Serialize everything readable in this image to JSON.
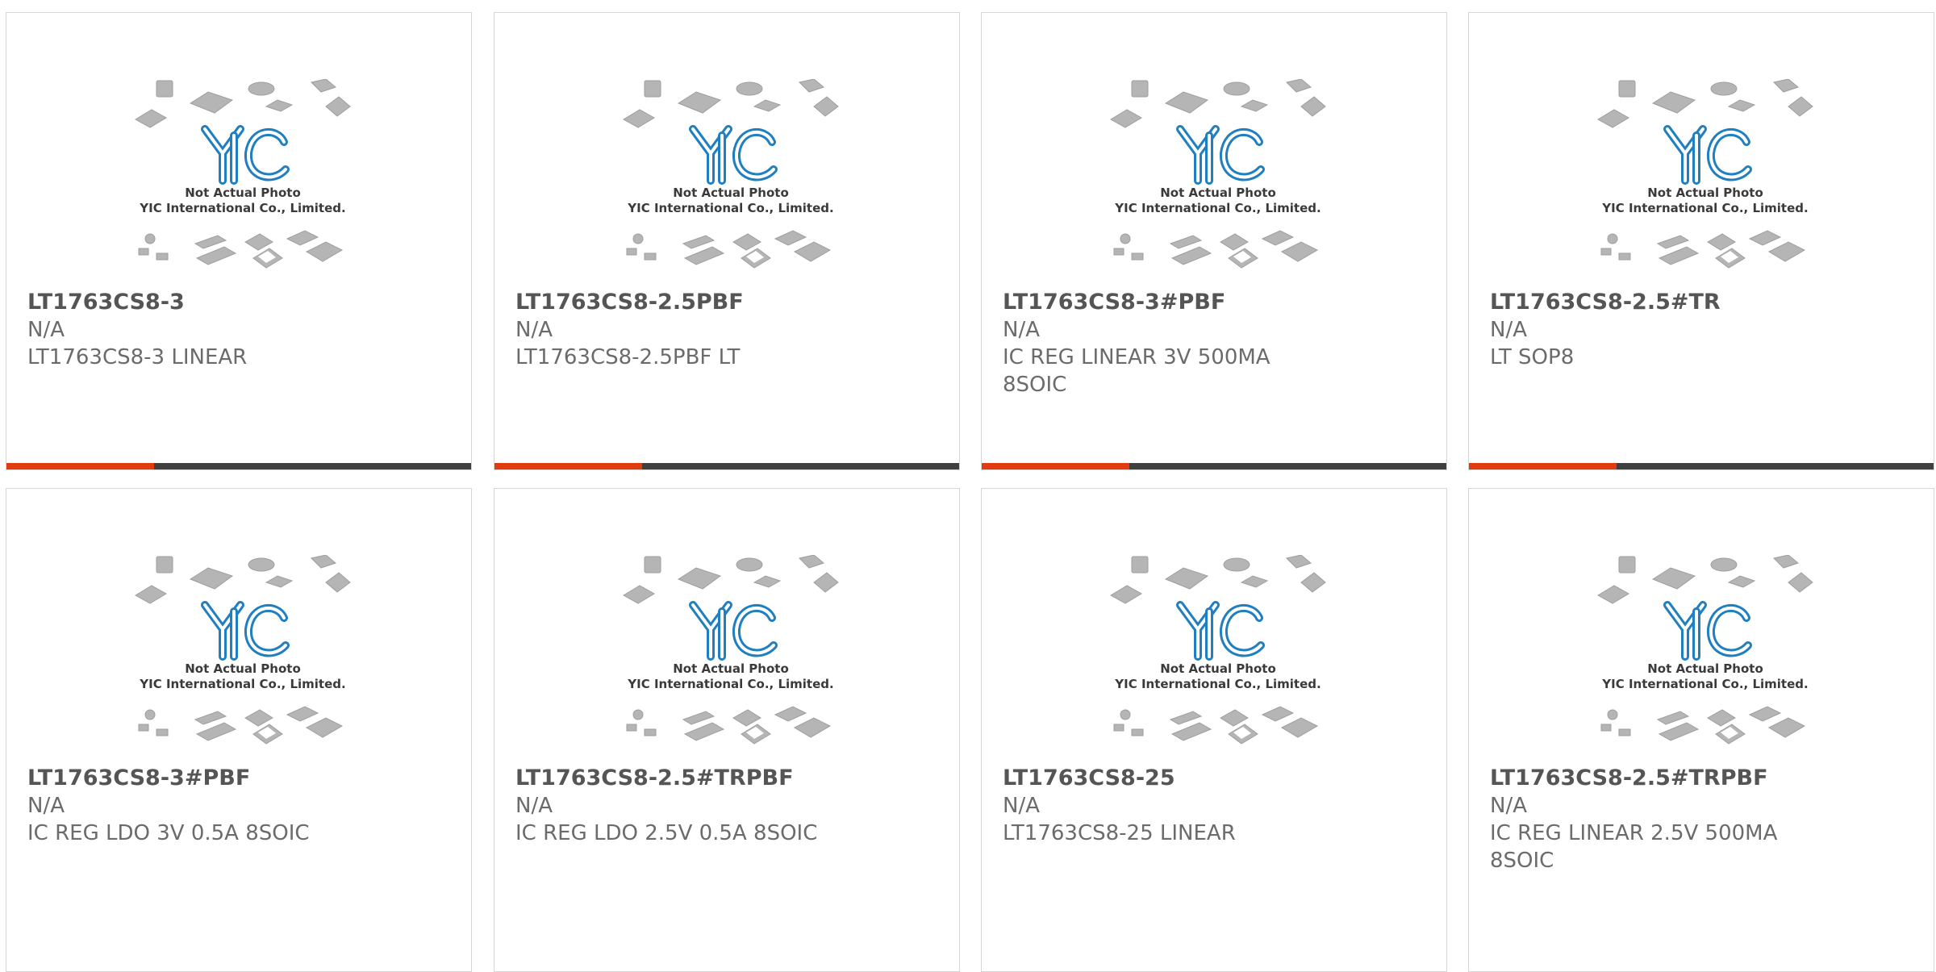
{
  "image_caption": {
    "line1": "Not Actual Photo",
    "line2": "YIC International Co., Limited.",
    "logo_text": "YIC"
  },
  "colors": {
    "accent": "#e03c10",
    "bar_dark": "#3f3f3f",
    "logo_blue": "#1f7fc1"
  },
  "products": [
    {
      "part": "LT1763CS8-3",
      "mfr": "N/A",
      "desc": "LT1763CS8-3 LINEAR"
    },
    {
      "part": "LT1763CS8-2.5PBF",
      "mfr": "N/A",
      "desc": "LT1763CS8-2.5PBF LT"
    },
    {
      "part": "LT1763CS8-3#PBF",
      "mfr": "N/A",
      "desc": "IC REG LINEAR 3V 500MA 8SOIC"
    },
    {
      "part": "LT1763CS8-2.5#TR",
      "mfr": "N/A",
      "desc": "LT SOP8"
    },
    {
      "part": "LT1763CS8-3#PBF",
      "mfr": "N/A",
      "desc": "IC REG LDO 3V 0.5A 8SOIC"
    },
    {
      "part": "LT1763CS8-2.5#TRPBF",
      "mfr": "N/A",
      "desc": "IC REG LDO 2.5V 0.5A 8SOIC"
    },
    {
      "part": "LT1763CS8-25",
      "mfr": "N/A",
      "desc": "LT1763CS8-25 LINEAR"
    },
    {
      "part": "LT1763CS8-2.5#TRPBF",
      "mfr": "N/A",
      "desc": "IC REG LINEAR 2.5V 500MA 8SOIC"
    }
  ]
}
